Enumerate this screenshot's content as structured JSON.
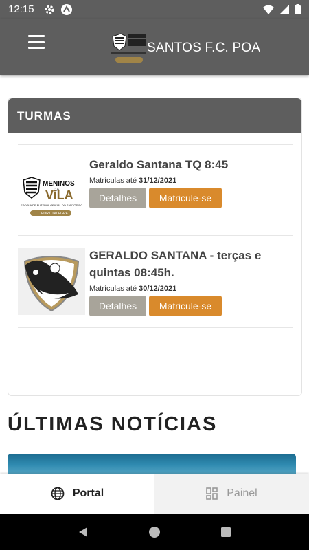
{
  "status_bar": {
    "time": "12:15"
  },
  "app_bar": {
    "title": "SANTOS F.C. POA"
  },
  "turmas": {
    "header": "TURMAS",
    "courses": [
      {
        "title": "Geraldo Santana TQ 8:45",
        "date_label": "Matrículas até",
        "date": "31/12/2021",
        "details_label": "Detalhes",
        "enroll_label": "Matricule-se",
        "logo_text_top": "MENINOS",
        "logo_text_vila": "VILA",
        "logo_sub": "ESCOLA DE FUTEBOL OFICIAL DO SANTOS F.C.",
        "logo_city": "PORTO ALEGRE"
      },
      {
        "title": "GERALDO SANTANA - terças e quintas 08:45h.",
        "date_label": "Matrículas até",
        "date": "30/12/2021",
        "details_label": "Detalhes",
        "enroll_label": "Matricule-se"
      }
    ]
  },
  "news": {
    "heading": "ÚLTIMAS NOTÍCIAS"
  },
  "bottom_nav": {
    "portal_label": "Portal",
    "panel_label": "Painel"
  },
  "colors": {
    "app_bar": "#5e5e5e",
    "details_button": "#a8a49a",
    "enroll_button": "#d98a2c"
  }
}
